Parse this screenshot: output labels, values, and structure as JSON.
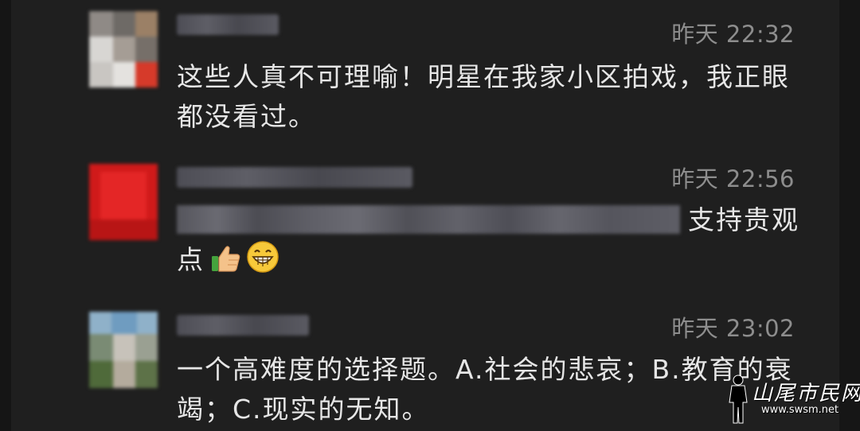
{
  "comments": [
    {
      "time": "昨天 22:32",
      "text": "这些人真不可理喻！明星在我家小区拍戏，我正眼都没看过。"
    },
    {
      "time": "昨天 22:56",
      "text": "支持贵观点",
      "emojis": [
        "thumbs-up-icon",
        "grinning-face-icon"
      ]
    },
    {
      "time": "昨天 23:02",
      "text": "一个高难度的选择题。A.社会的悲哀；B.教育的衰竭；C.现实的无知。"
    }
  ],
  "watermark": {
    "text": "山尾市民网",
    "url": "www.swsm.net"
  }
}
